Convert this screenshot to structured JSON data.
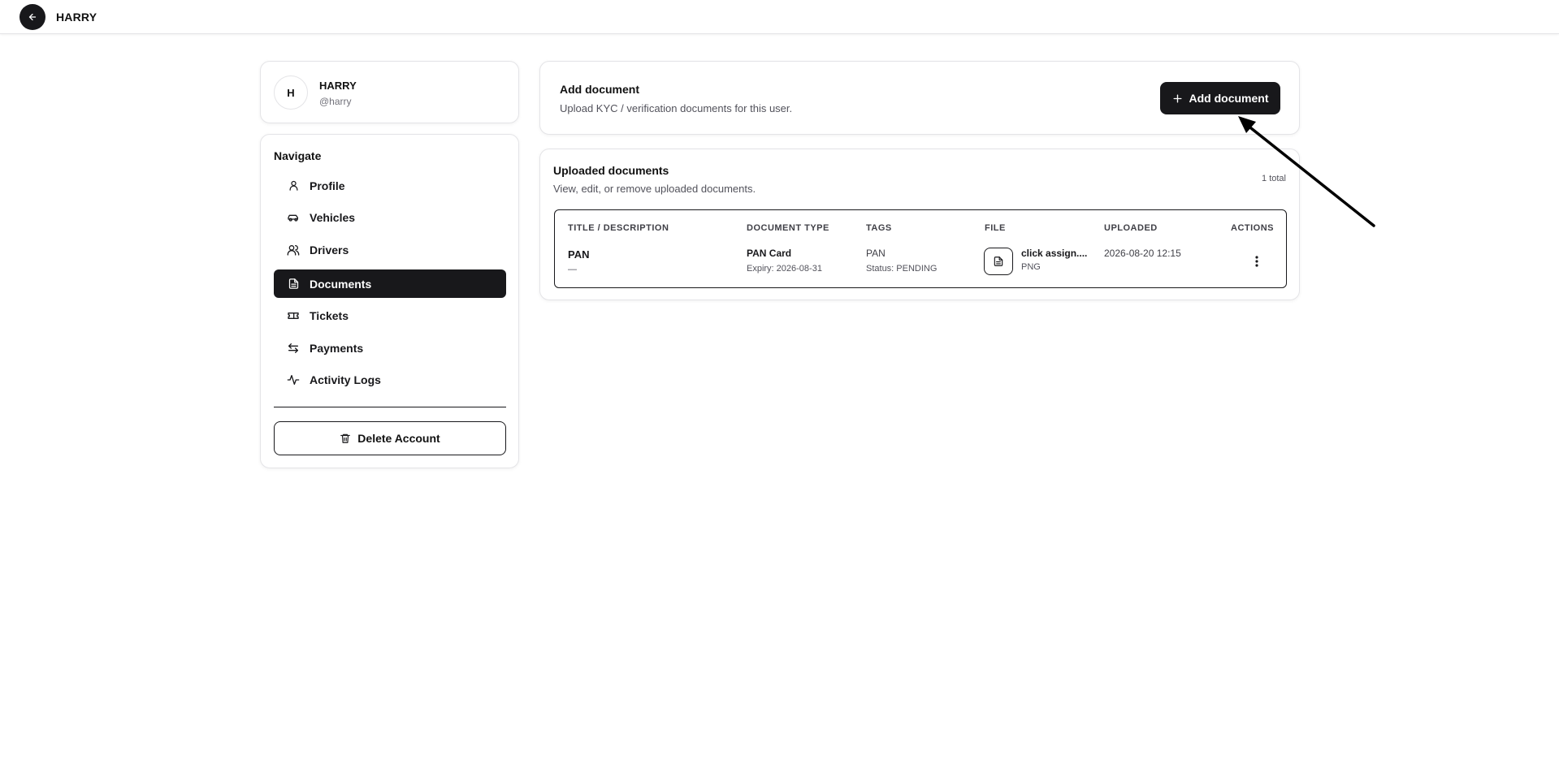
{
  "topbar": {
    "title": "HARRY"
  },
  "user": {
    "initial": "H",
    "name": "HARRY",
    "handle": "@harry"
  },
  "nav": {
    "title": "Navigate",
    "items": [
      {
        "label": "Profile",
        "icon": "user-icon",
        "active": false
      },
      {
        "label": "Vehicles",
        "icon": "car-icon",
        "active": false
      },
      {
        "label": "Drivers",
        "icon": "users-icon",
        "active": false
      },
      {
        "label": "Documents",
        "icon": "file-text-icon",
        "active": true
      },
      {
        "label": "Tickets",
        "icon": "ticket-icon",
        "active": false
      },
      {
        "label": "Payments",
        "icon": "arrows-left-right-icon",
        "active": false
      },
      {
        "label": "Activity Logs",
        "icon": "activity-icon",
        "active": false
      }
    ],
    "delete_label": "Delete Account"
  },
  "add_document": {
    "title": "Add document",
    "subtitle": "Upload KYC / verification documents for this user.",
    "button_label": "Add document"
  },
  "uploaded": {
    "title": "Uploaded documents",
    "subtitle": "View, edit, or remove uploaded documents.",
    "total": "1 total",
    "columns": [
      "TITLE / DESCRIPTION",
      "DOCUMENT TYPE",
      "TAGS",
      "FILE",
      "UPLOADED",
      "ACTIONS"
    ],
    "rows": [
      {
        "title": "PAN",
        "description": "—",
        "doc_type": "PAN Card",
        "expiry": "Expiry: 2026-08-31",
        "tag": "PAN",
        "status": "Status: PENDING",
        "file_name": "click assign....",
        "file_type": "PNG",
        "uploaded": "2026-08-20 12:15"
      }
    ]
  },
  "colors": {
    "primary": "#18181b",
    "border": "#e4e4e7",
    "muted": "#52525b"
  }
}
